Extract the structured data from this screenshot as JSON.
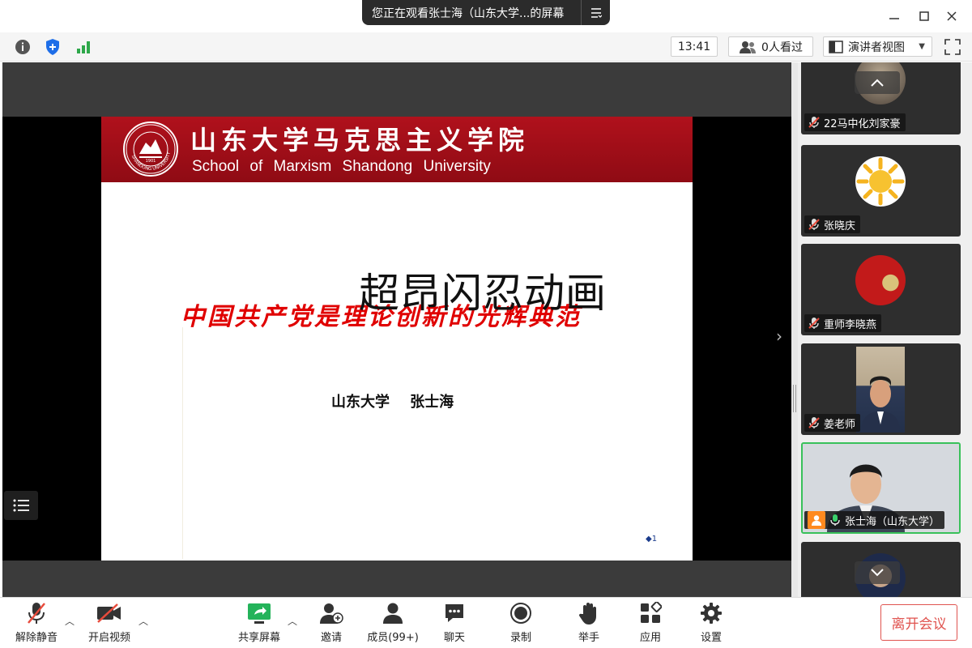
{
  "titlebar": {
    "share_banner": "您正在观看张士海（山东大学...的屏幕",
    "minimize": "—",
    "maximize": "☐",
    "close": "✕"
  },
  "toolbar": {
    "time": "13:41",
    "viewers": "0人看过",
    "view_mode": "演讲者视图"
  },
  "slide": {
    "header_cn": "山东大学马克思主义学院",
    "header_en": "School of Marxism Shandong University",
    "overlay_title": "超昂闪忍动画",
    "main_title": "中国共产党是理论创新的光辉典范",
    "author": "山东大学    张士海",
    "page_number": "1",
    "logo_year": "1901",
    "logo_text": "SHANDONG UNIVERSITY"
  },
  "participants": [
    {
      "name": "22马中化刘家豪",
      "muted": true
    },
    {
      "name": "张晓庆",
      "muted": true
    },
    {
      "name": "重师李晓燕",
      "muted": true
    },
    {
      "name": "姜老师",
      "muted": true
    },
    {
      "name": "张士海（山东大学）",
      "muted": false,
      "host": true,
      "speaking": true
    },
    {
      "name": "",
      "muted": true
    }
  ],
  "bottombar": {
    "unmute": "解除静音",
    "start_video": "开启视频",
    "share_screen": "共享屏幕",
    "invite": "邀请",
    "members": "成员(99+)",
    "chat": "聊天",
    "record": "录制",
    "raise_hand": "举手",
    "apps": "应用",
    "settings": "设置",
    "leave": "离开会议"
  },
  "colors": {
    "slide_header": "#a0101a",
    "main_title": "#e00000",
    "active_tile_border": "#39c15a",
    "leave_button": "#e0534f",
    "host_badge": "#ff8a1f"
  }
}
